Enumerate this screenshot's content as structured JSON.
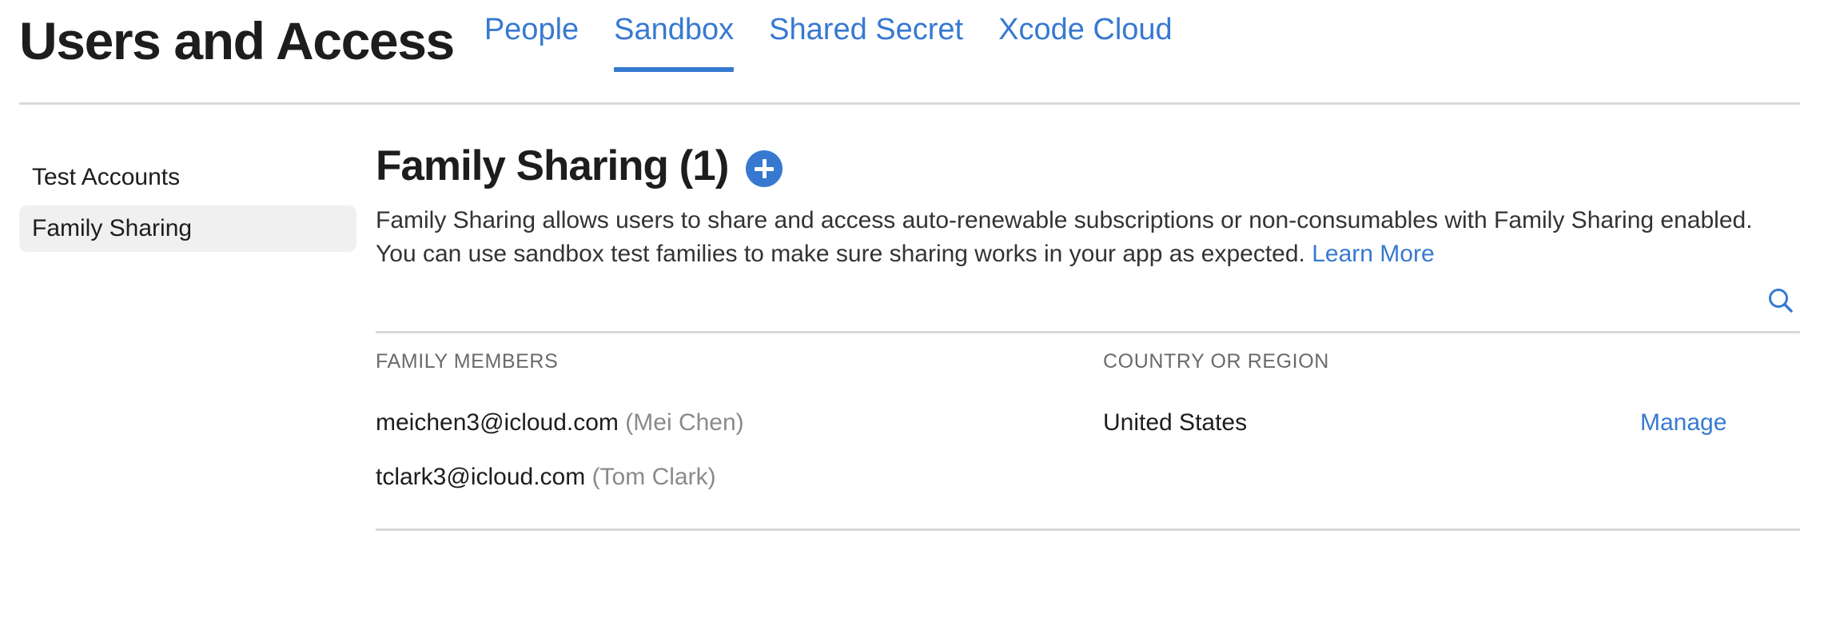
{
  "header": {
    "title": "Users and Access",
    "tabs": [
      {
        "label": "People",
        "active": false
      },
      {
        "label": "Sandbox",
        "active": true
      },
      {
        "label": "Shared Secret",
        "active": false
      },
      {
        "label": "Xcode Cloud",
        "active": false
      }
    ],
    "accent_color": "#3779d1"
  },
  "sidebar": {
    "items": [
      {
        "label": "Test Accounts",
        "selected": false
      },
      {
        "label": "Family Sharing",
        "selected": true
      }
    ],
    "selected_background": "#f0f0f0"
  },
  "main": {
    "section_title": "Family Sharing (1)",
    "add_button_label": "+",
    "description": {
      "text": "Family Sharing allows users to share and access auto-renewable subscriptions or non-consumables with Family Sharing enabled. You can use sandbox test families to make sure sharing works in your app as expected.",
      "link_label": "Learn More"
    },
    "search": {
      "icon": "search-icon",
      "color": "#3779d1"
    },
    "table": {
      "columns": [
        {
          "key": "members",
          "label": "FAMILY MEMBERS"
        },
        {
          "key": "country",
          "label": "COUNTRY OR REGION"
        },
        {
          "key": "action",
          "label": ""
        }
      ],
      "rows": [
        {
          "email": "meichen3@icloud.com",
          "name": "(Mei Chen)",
          "country": "United States",
          "action": "Manage"
        },
        {
          "email": "tclark3@icloud.com",
          "name": "(Tom Clark)",
          "country": "",
          "action": ""
        }
      ]
    }
  }
}
